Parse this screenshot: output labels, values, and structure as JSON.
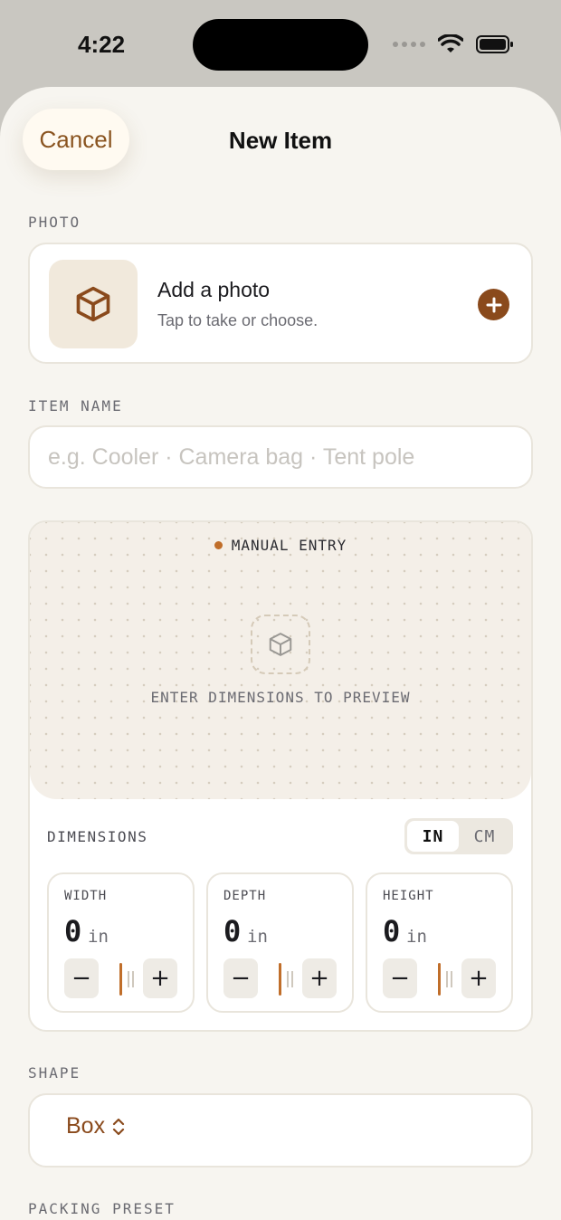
{
  "status_bar": {
    "time": "4:22"
  },
  "header": {
    "cancel_label": "Cancel",
    "title": "New Item"
  },
  "photo": {
    "section_label": "PHOTO",
    "title": "Add a photo",
    "subtitle": "Tap to take or choose."
  },
  "item_name": {
    "section_label": "ITEM NAME",
    "value": "",
    "placeholder": "e.g. Cooler · Camera bag · Tent pole"
  },
  "preview": {
    "mode_label": "MANUAL ENTRY",
    "hint": "ENTER DIMENSIONS TO PREVIEW"
  },
  "dimensions": {
    "section_label": "DIMENSIONS",
    "units": [
      "IN",
      "CM"
    ],
    "selected_unit": "IN",
    "fields": [
      {
        "label": "WIDTH",
        "value": "0",
        "unit": "in"
      },
      {
        "label": "DEPTH",
        "value": "0",
        "unit": "in"
      },
      {
        "label": "HEIGHT",
        "value": "0",
        "unit": "in"
      }
    ],
    "minus_label": "−",
    "plus_label": "+"
  },
  "shape": {
    "section_label": "SHAPE",
    "selected": "Box"
  },
  "packing_preset": {
    "section_label": "PACKING PRESET"
  },
  "colors": {
    "accent": "#8a4a1c",
    "slider": "#c06e2a",
    "sheet_bg": "#f7f5f0"
  }
}
